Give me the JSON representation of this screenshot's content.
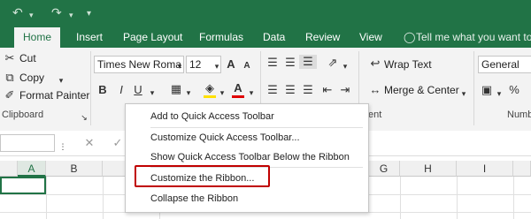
{
  "qat": {
    "undo_icon": "undo-icon",
    "redo_icon": "redo-icon",
    "customize_icon": "qat-dropdown-icon"
  },
  "tabs": [
    {
      "label": "Home",
      "active": true
    },
    {
      "label": "Insert",
      "active": false
    },
    {
      "label": "Page Layout",
      "active": false
    },
    {
      "label": "Formulas",
      "active": false
    },
    {
      "label": "Data",
      "active": false
    },
    {
      "label": "Review",
      "active": false
    },
    {
      "label": "View",
      "active": false
    }
  ],
  "tell_me": "Tell me what you want to d",
  "ribbon": {
    "clipboard": {
      "cut": "Cut",
      "copy": "Copy",
      "format_painter": "Format Painter",
      "group_label": "Clipboard"
    },
    "font": {
      "name": "Times New Roma",
      "size": "12",
      "bold": "B",
      "italic": "I",
      "underline": "U",
      "font_color_letter": "A",
      "grow": "A",
      "shrink": "A"
    },
    "alignment": {
      "wrap_text": "Wrap Text",
      "merge_center": "Merge & Center",
      "group_label": "ent"
    },
    "number": {
      "format": "General",
      "percent": "%",
      "group_label": "Numb"
    }
  },
  "context_menu": {
    "items": [
      "Add to Quick Access Toolbar",
      "Customize Quick Access Toolbar...",
      "Show Quick Access Toolbar Below the Ribbon",
      "Customize the Ribbon...",
      "Collapse the Ribbon"
    ],
    "highlighted_index": 3
  },
  "columns": [
    "A",
    "B",
    "G",
    "H",
    "I"
  ],
  "colors": {
    "excel_green": "#217346",
    "highlight_red": "#c00000"
  }
}
